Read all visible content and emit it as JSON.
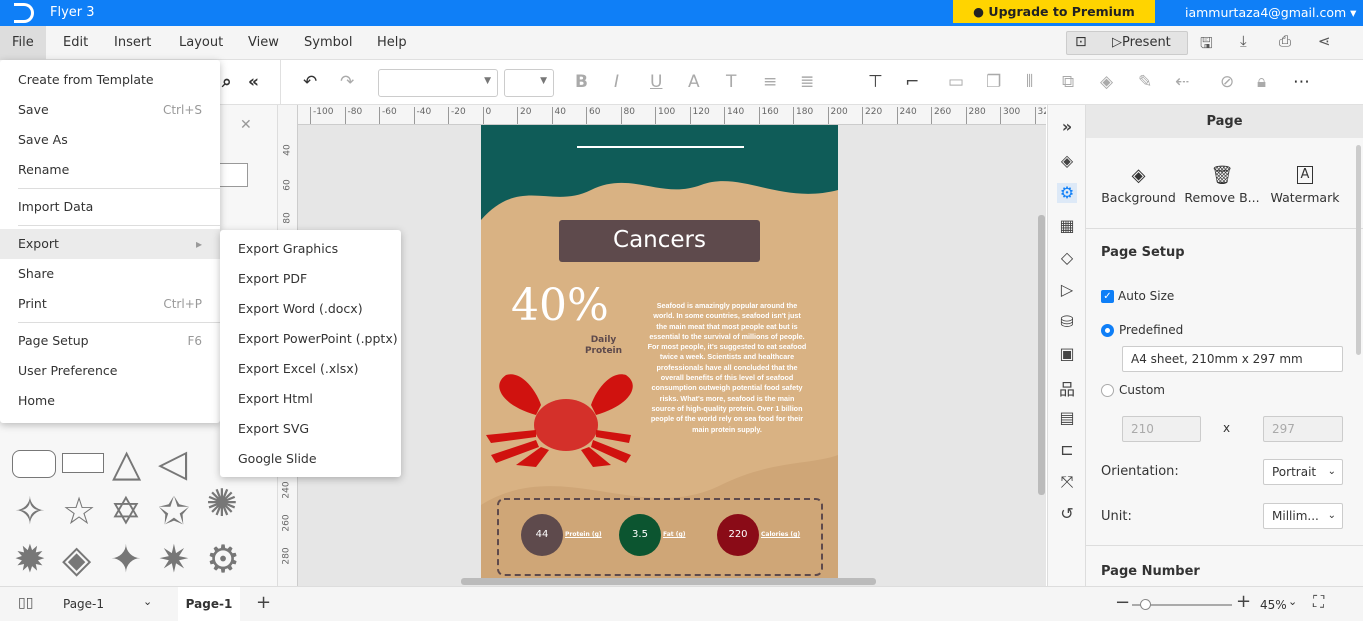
{
  "titlebar": {
    "app_title": "Flyer 3",
    "upgrade": "● Upgrade to Premium Version",
    "account": "iammurtaza4@gmail.com ▾"
  },
  "menubar": {
    "items": [
      "File",
      "Edit",
      "Insert",
      "Layout",
      "View",
      "Symbol",
      "Help"
    ],
    "present": "Present"
  },
  "file_menu": {
    "items": [
      {
        "label": "Create from Template",
        "shortcut": ""
      },
      {
        "label": "Save",
        "shortcut": "Ctrl+S"
      },
      {
        "label": "Save As",
        "shortcut": ""
      },
      {
        "label": "Rename",
        "shortcut": ""
      },
      {
        "label": "Import Data",
        "shortcut": ""
      },
      {
        "label": "Export",
        "shortcut": "▸"
      },
      {
        "label": "Share",
        "shortcut": ""
      },
      {
        "label": "Print",
        "shortcut": "Ctrl+P"
      },
      {
        "label": "Page Setup",
        "shortcut": "F6"
      },
      {
        "label": "User Preference",
        "shortcut": ""
      },
      {
        "label": "Home",
        "shortcut": ""
      }
    ]
  },
  "export_menu": {
    "items": [
      "Export Graphics",
      "Export PDF",
      "Export Word (.docx)",
      "Export PowerPoint (.pptx)",
      "Export Excel (.xlsx)",
      "Export Html",
      "Export SVG",
      "Google Slide"
    ]
  },
  "ruler": {
    "top": [
      "-100",
      "-80",
      "-60",
      "-40",
      "-20",
      "0",
      "20",
      "40",
      "60",
      "80",
      "100",
      "120",
      "140",
      "160",
      "180",
      "200",
      "220",
      "240",
      "260",
      "280",
      "300",
      "320"
    ],
    "left": [
      "40",
      "60",
      "80",
      "240",
      "260",
      "280"
    ]
  },
  "flyer": {
    "title": "Cancers",
    "percent": "40%",
    "percent_label": "Daily Protein",
    "body": "Seafood is amazingly popular around the world. In some countries, seafood isn't just the main meat that most people eat but is essential to the survival of millions of people. For most people, it's suggested to eat seafood twice a week. Scientists and healthcare professionals have all concluded that the overall benefits of this level of seafood consumption outweigh potential food safety risks. What's more, seafood is the main source of high-quality protein. Over 1 billion people of the world rely on sea food for their main protein supply.",
    "stats": [
      {
        "value": "44",
        "label": "Protein (g)",
        "color": "#5e4a4c"
      },
      {
        "value": "3.5",
        "label": "Fat (g)",
        "color": "#0c5530"
      },
      {
        "value": "220",
        "label": "Calories (g)",
        "color": "#8a0b17"
      }
    ],
    "colors": {
      "teal": "#0f5c58",
      "sand": "#d9b283",
      "title_box": "#5e4a4c",
      "crab": "#d0120f"
    }
  },
  "right_panel": {
    "header": "Page",
    "actions": [
      "Background",
      "Remove B...",
      "Watermark"
    ],
    "page_setup": "Page Setup",
    "auto_size": "Auto Size",
    "predefined": "Predefined",
    "predefined_value": "A4 sheet, 210mm x 297 mm",
    "custom": "Custom",
    "width": "210",
    "x": "x",
    "height": "297",
    "orientation_label": "Orientation:",
    "orientation": "Portrait",
    "unit_label": "Unit:",
    "unit": "Millim...",
    "page_number": "Page Number"
  },
  "bottombar": {
    "page_select": "Page-1",
    "page_tab": "Page-1",
    "zoom": "45%"
  }
}
